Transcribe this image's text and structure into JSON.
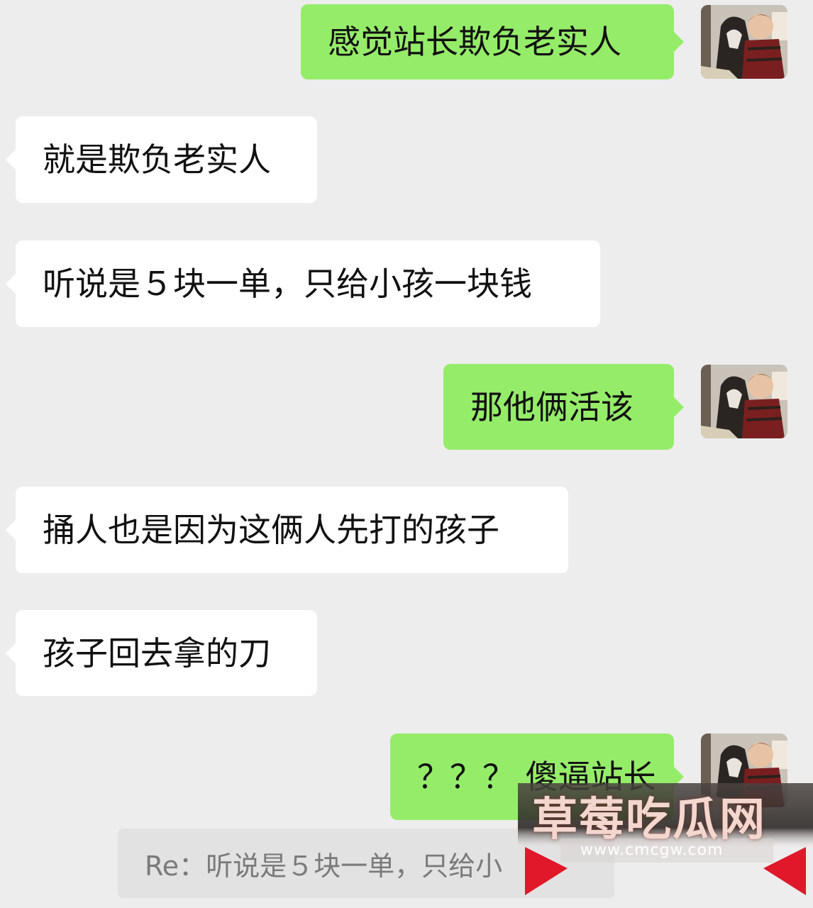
{
  "messages": [
    {
      "id": "m1",
      "side": "out",
      "text": "感觉站长欺负老实人"
    },
    {
      "id": "m2",
      "side": "in",
      "text": "就是欺负老实人"
    },
    {
      "id": "m3",
      "side": "in",
      "text": "听说是５块一单，只给小孩一块钱"
    },
    {
      "id": "m4",
      "side": "out",
      "text": "那他俩活该"
    },
    {
      "id": "m5",
      "side": "in",
      "text": "捅人也是因为这俩人先打的孩子"
    },
    {
      "id": "m6",
      "side": "in",
      "text": "孩子回去拿的刀"
    },
    {
      "id": "m7",
      "side": "out",
      "text": "？？？ 傻逼站长"
    }
  ],
  "quote": {
    "text": "Re：听说是５块一单，只给小"
  },
  "watermark": {
    "title": "草莓吃瓜网",
    "url": "www.cmcgw.com"
  },
  "colors": {
    "background": "#ededed",
    "outgoing_bubble": "#95ec69",
    "incoming_bubble": "#ffffff",
    "quote_background": "#e2e2e2",
    "quote_text": "#7a7a7a"
  },
  "icons": {
    "avatar": "user-avatar-photo-dog-and-child",
    "watermark_triangles": "red-triangle-icon"
  }
}
